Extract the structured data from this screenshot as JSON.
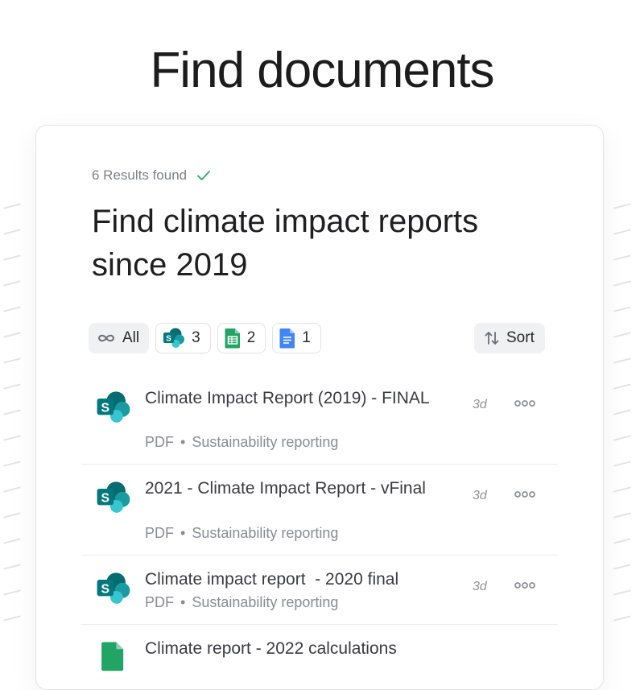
{
  "hero": {
    "title": "Find documents"
  },
  "results": {
    "text": "6 Results found"
  },
  "query": {
    "text": "Find climate impact reports since 2019"
  },
  "filters": {
    "all_label": "All",
    "sharepoint_count": "3",
    "sheets_count": "2",
    "docs_count": "1"
  },
  "sort": {
    "label": "Sort"
  },
  "documents": [
    {
      "title": "Climate Impact Report (2019) - FINAL",
      "type": "PDF",
      "source": "Sustainability reporting",
      "time": "3d",
      "icon": "sharepoint-icon"
    },
    {
      "title": "2021 - Climate Impact Report - vFinal",
      "type": "PDF",
      "source": "Sustainability reporting",
      "time": "3d",
      "icon": "sharepoint-icon"
    },
    {
      "title": "Climate impact report  - 2020 final",
      "type": "PDF",
      "source": "Sustainability reporting",
      "time": "3d",
      "icon": "sharepoint-icon"
    },
    {
      "title": "Climate report - 2022 calculations",
      "type": "",
      "source": "",
      "time": "",
      "icon": "sheets-icon"
    }
  ],
  "colors": {
    "sharepoint_dark": "#036c70",
    "sharepoint_mid": "#1a9ba1",
    "sharepoint_light": "#37c6d0",
    "sheets_green": "#21a464",
    "docs_blue": "#4285f4",
    "check_green": "#3bb273"
  }
}
